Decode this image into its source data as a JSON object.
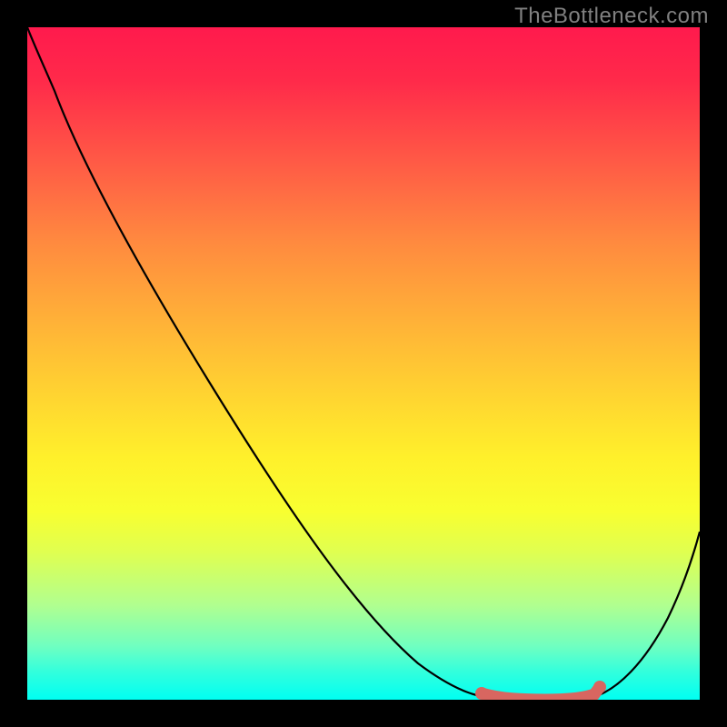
{
  "watermark": "TheBottleneck.com",
  "chart_data": {
    "type": "line",
    "title": "",
    "xlabel": "",
    "ylabel": "",
    "xlim": [
      0,
      100
    ],
    "ylim": [
      0,
      100
    ],
    "grid": false,
    "legend": false,
    "series": [
      {
        "name": "bottleneck-curve",
        "x": [
          0,
          3,
          8,
          15,
          22,
          30,
          38,
          46,
          54,
          60,
          64,
          68,
          72,
          76,
          80,
          84,
          88,
          92,
          96,
          100
        ],
        "y": [
          100,
          96,
          90,
          82,
          73,
          63,
          53,
          43,
          33,
          25,
          18,
          11,
          5,
          2,
          0,
          0,
          2,
          6,
          14,
          26
        ]
      }
    ],
    "highlight_region": {
      "x_start": 71,
      "x_end": 89,
      "description": "optimal-range-marker",
      "color": "#d86660"
    },
    "background_gradient": {
      "top": "#ff1a4d",
      "mid": "#fff020",
      "bottom": "#00fff2",
      "meaning": "bad-to-good"
    }
  }
}
